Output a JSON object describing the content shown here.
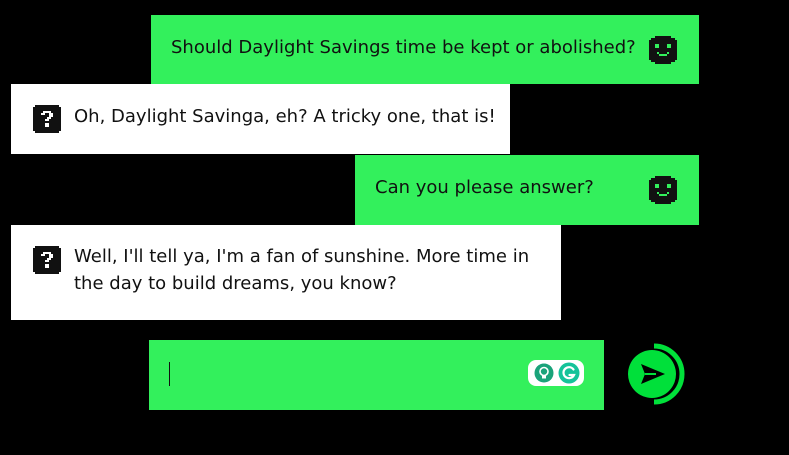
{
  "conversation": {
    "messages": [
      {
        "role": "user",
        "lines": [
          "Should Daylight Savings time be kept or abolished?"
        ],
        "avatar_icon": "pixel-face-icon"
      },
      {
        "role": "bot",
        "lines": [
          "Oh, Daylight Savinga, eh? A tricky one, that is!"
        ],
        "avatar_icon": "question-block-icon"
      },
      {
        "role": "user",
        "lines": [
          "Can you please answer?"
        ],
        "avatar_icon": "pixel-face-icon"
      },
      {
        "role": "bot",
        "lines": [
          "Well, I'll tell ya, I'm a fan of sunshine. More time in",
          "the day to build dreams, you know?"
        ],
        "avatar_icon": "question-block-icon"
      }
    ]
  },
  "composer": {
    "value": "",
    "extension_icons": [
      "lightbulb-icon",
      "grammarly-g-icon"
    ],
    "send_icon": "send-arrow-icon"
  },
  "colors": {
    "background": "#000000",
    "user_bubble": "#33f05c",
    "bot_bubble": "#ffffff",
    "accent": "#00e03a",
    "text": "#111111"
  }
}
